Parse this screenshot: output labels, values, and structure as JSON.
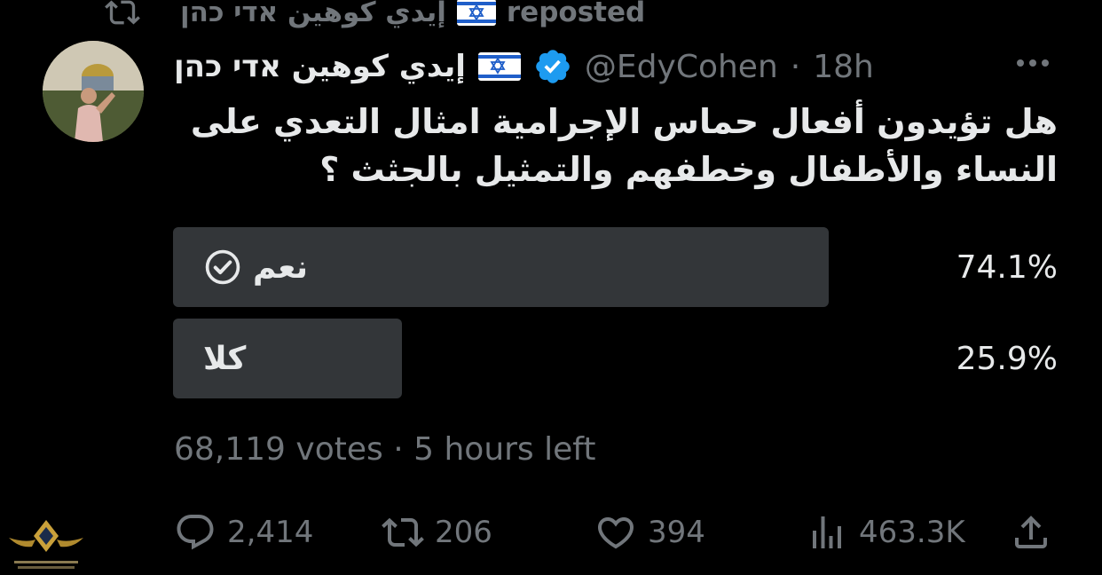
{
  "repost": {
    "reposter_name": "إيدي كوهين אדי כהן",
    "label": "reposted"
  },
  "post": {
    "author_name": "إيدي كوهين אדי כהן",
    "handle": "@EdyCohen",
    "separator": "·",
    "time_ago": "18h",
    "text_lines": [
      "هل تؤيدون أفعال حماس الإجرامية امثال التعدي على",
      "النساء والأطفال وخطفهم  والتمثيل  بالجثث ؟"
    ]
  },
  "poll": {
    "options": [
      {
        "label": "نعم",
        "percent_text": "74.1%",
        "percent": 74.1,
        "selected": true
      },
      {
        "label": "كلا",
        "percent_text": "25.9%",
        "percent": 25.9,
        "selected": false
      }
    ],
    "votes": "68,119 votes",
    "separator": "·",
    "time_left": "5 hours left"
  },
  "actions": {
    "replies": "2,414",
    "reposts": "206",
    "likes": "394",
    "views": "463.3K"
  },
  "icons": {
    "repost": "repost-icon",
    "verified": "verified-badge-icon",
    "more": "more-icon",
    "check": "check-circle-icon",
    "reply": "reply-icon",
    "like": "heart-icon",
    "views": "views-chart-icon",
    "share": "share-icon",
    "flag": "israel-flag-icon"
  },
  "colors": {
    "background": "#000000",
    "text": "#e7e9ea",
    "muted": "#71767b",
    "poll_bar": "#333639",
    "verified": "#1d9bf0",
    "flag_blue": "#1f5ec9"
  }
}
